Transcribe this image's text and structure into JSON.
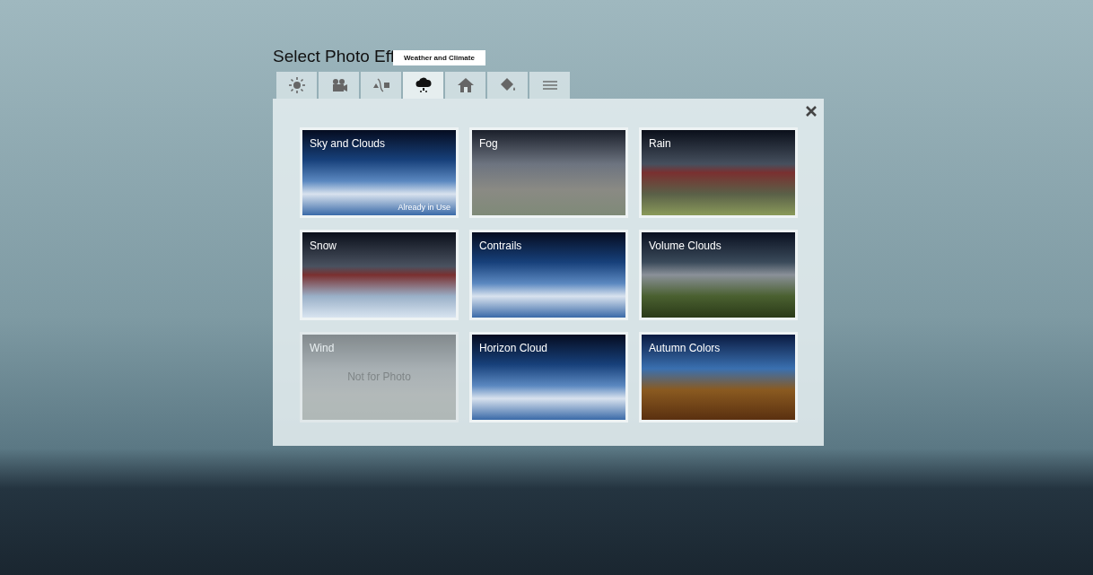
{
  "dialog": {
    "title": "Select Photo Eff",
    "tooltip": "Weather and Climate",
    "tabs": [
      {
        "selected": false
      },
      {
        "selected": false
      },
      {
        "selected": false
      },
      {
        "selected": true
      },
      {
        "selected": false
      },
      {
        "selected": false
      },
      {
        "selected": false
      }
    ],
    "effects": [
      {
        "label": "Sky and Clouds",
        "disabled": false,
        "note": "Already in Use"
      },
      {
        "label": "Fog",
        "disabled": false
      },
      {
        "label": "Rain",
        "disabled": false
      },
      {
        "label": "Snow",
        "disabled": false
      },
      {
        "label": "Contrails",
        "disabled": false
      },
      {
        "label": "Volume Clouds",
        "disabled": false
      },
      {
        "label": "Wind",
        "disabled": true,
        "note": "Not for Photo"
      },
      {
        "label": "Horizon Cloud",
        "disabled": false
      },
      {
        "label": "Autumn Colors",
        "disabled": false
      }
    ]
  }
}
